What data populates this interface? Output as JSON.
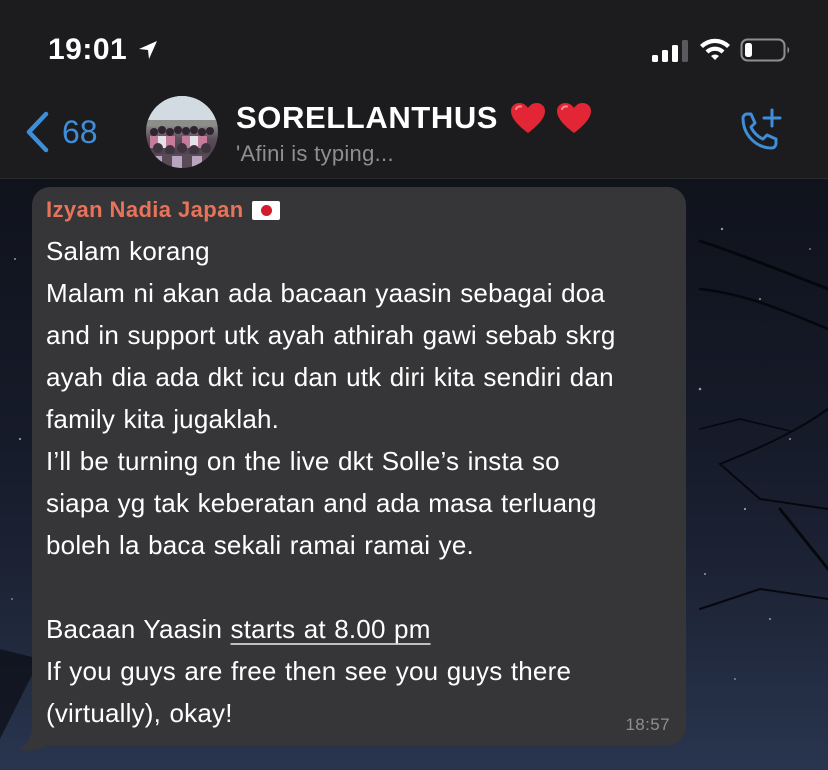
{
  "status_bar": {
    "time": "19:01",
    "location_icon": "location-arrow-icon",
    "signal_icon": "cellular-signal-icon",
    "wifi_icon": "wifi-icon",
    "battery_icon": "battery-low-icon"
  },
  "header": {
    "back_count": "68",
    "back_icon": "chevron-left-icon",
    "chat_name": "SORELLANTHUS",
    "emoji": [
      "red-heart-emoji",
      "red-heart-emoji"
    ],
    "typing_status": "'Afini  is typing...",
    "call_icon": "phone-add-icon",
    "accent_color": "#3e8eda"
  },
  "message": {
    "sender": "Izyan Nadia Japan",
    "sender_flag": "japan-flag-emoji",
    "sender_color": "#e8735a",
    "lines": [
      "Salam korang",
      "Malam ni akan ada bacaan yaasin sebagai doa",
      "and in support utk ayah athirah gawi sebab skrg",
      "ayah dia ada dkt icu dan utk diri kita sendiri dan",
      "family kita jugaklah.",
      "I’ll be turning on the live dkt Solle’s insta so",
      "siapa yg tak keberatan and ada masa terluang",
      "boleh la baca sekali ramai ramai ye.",
      "",
      "Bacaan Yaasin ",
      "If you guys are free then see you guys there",
      "(virtually), okay!"
    ],
    "link_text": "starts at 8.00 pm",
    "time": "18:57",
    "bubble_color": "#363638"
  }
}
